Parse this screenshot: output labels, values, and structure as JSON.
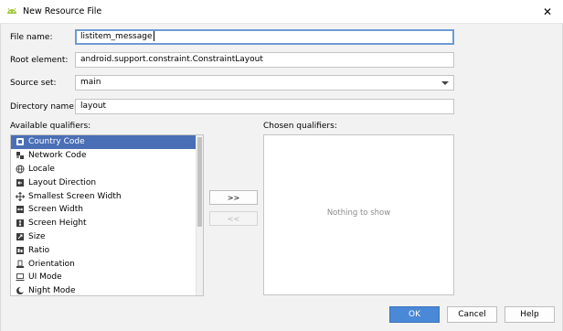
{
  "window": {
    "title": "New Resource File",
    "close_glyph": "✕"
  },
  "form": {
    "file_name_label": "File name:",
    "file_name_value": "listitem_message",
    "root_element_label": "Root element:",
    "root_element_value": "android.support.constraint.ConstraintLayout",
    "source_set_label": "Source set:",
    "source_set_value": "main",
    "directory_name_label": "Directory name:",
    "directory_name_value": "layout"
  },
  "qualifiers": {
    "available_label": "Available qualifiers:",
    "chosen_label": "Chosen qualifiers:",
    "available": [
      {
        "label": "Country Code",
        "icon": "country-code-icon",
        "selected": true
      },
      {
        "label": "Network Code",
        "icon": "network-code-icon",
        "selected": false
      },
      {
        "label": "Locale",
        "icon": "locale-globe-icon",
        "selected": false
      },
      {
        "label": "Layout Direction",
        "icon": "layout-direction-icon",
        "selected": false
      },
      {
        "label": "Smallest Screen Width",
        "icon": "smallest-screen-width-icon",
        "selected": false
      },
      {
        "label": "Screen Width",
        "icon": "screen-width-icon",
        "selected": false
      },
      {
        "label": "Screen Height",
        "icon": "screen-height-icon",
        "selected": false
      },
      {
        "label": "Size",
        "icon": "size-icon",
        "selected": false
      },
      {
        "label": "Ratio",
        "icon": "ratio-icon",
        "selected": false
      },
      {
        "label": "Orientation",
        "icon": "orientation-icon",
        "selected": false
      },
      {
        "label": "UI Mode",
        "icon": "ui-mode-icon",
        "selected": false
      },
      {
        "label": "Night Mode",
        "icon": "night-mode-icon",
        "selected": false
      }
    ],
    "chosen_empty_text": "Nothing to show",
    "add_button": ">>",
    "remove_button": "<<"
  },
  "buttons": {
    "ok": "OK",
    "cancel": "Cancel",
    "help": "Help"
  },
  "colors": {
    "selection": "#4a6fb6",
    "primary_button": "#4a88d8",
    "focus_border": "#6e9bd6",
    "android_green": "#a4c639"
  }
}
